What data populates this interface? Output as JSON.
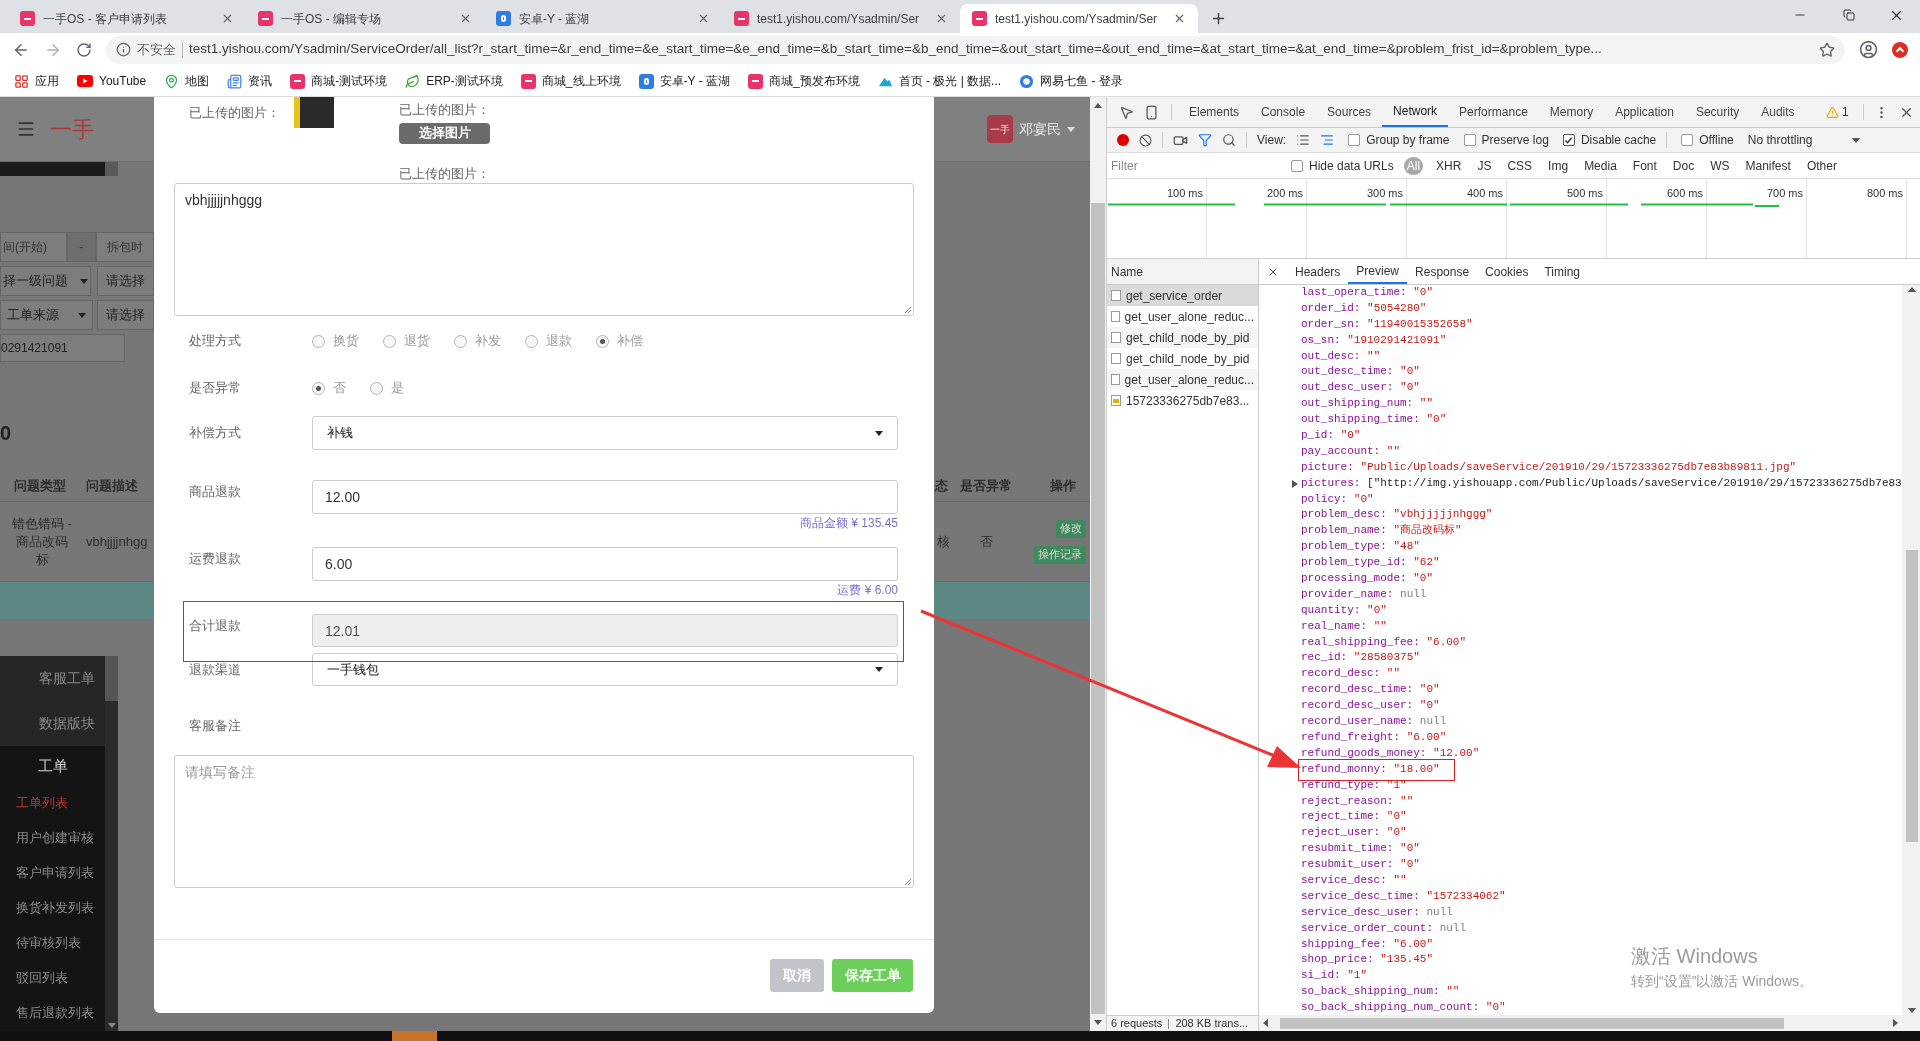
{
  "browser": {
    "tabs": [
      {
        "title": "一手OS - 客户申请列表",
        "kind": "yishou",
        "selected": false
      },
      {
        "title": "一手OS - 编辑专场",
        "kind": "yishou",
        "selected": false
      },
      {
        "title": "安卓-Y - 蓝湖",
        "kind": "lanhu",
        "selected": false
      },
      {
        "title": "test1.yishou.com/Ysadmin/Ser",
        "kind": "yishou",
        "selected": false
      },
      {
        "title": "test1.yishou.com/Ysadmin/Ser",
        "kind": "yishou",
        "selected": true
      }
    ],
    "address_bar": {
      "security": "不安全",
      "url": "test1.yishou.com/Ysadmin/ServiceOrder/all_list?r_start_time=&r_end_time=&e_start_time=&e_end_time=&b_start_time=&b_end_time=&out_start_time=&out_end_time=&at_start_time=&at_end_time=&problem_frist_id=&problem_type..."
    },
    "bookmarks": [
      {
        "label": "应用",
        "kind": "apps"
      },
      {
        "label": "YouTube",
        "kind": "youtube"
      },
      {
        "label": "地图",
        "kind": "maps"
      },
      {
        "label": "资讯",
        "kind": "news"
      },
      {
        "label": "商城-测试环境",
        "kind": "yishou"
      },
      {
        "label": "ERP-测试环境",
        "kind": "erp"
      },
      {
        "label": "商城_线上环境",
        "kind": "yishou"
      },
      {
        "label": "安卓-Y - 蓝湖",
        "kind": "lanhu"
      },
      {
        "label": "商城_预发布环境",
        "kind": "yishou"
      },
      {
        "label": "首页 - 极光 | 数据...",
        "kind": "jiguang"
      },
      {
        "label": "网易七鱼 - 登录",
        "kind": "qiyu"
      }
    ]
  },
  "page": {
    "header": {
      "logo": "一手",
      "user_badge": "一手",
      "user_name": "邓宴民"
    },
    "filters": {
      "start_time": "间(开始)",
      "separator": "-",
      "unpack_time": "拆包时",
      "problem_select": "择一级问题",
      "problem_type_select": "请选择",
      "source_select": "工单来源",
      "source_type_select": "请选择",
      "order_search": "0291421091"
    },
    "total": "0",
    "table": {
      "columns_left": [
        "问题类型",
        "问题描述"
      ],
      "columns_right": [
        "态",
        "是否异常",
        "操作"
      ],
      "row": {
        "problem_type": "错色错码 - 商品改码标",
        "problem_desc": "vbhjjjjnhgg",
        "status": "核",
        "abnormal": "否",
        "actions": [
          "修改",
          "操作记录"
        ]
      }
    },
    "sidebar": {
      "items": [
        {
          "label": "客服工单",
          "selected": false
        },
        {
          "label": "数据版块",
          "selected": false
        }
      ],
      "section": {
        "title": "工单",
        "items": [
          {
            "label": "工单列表",
            "selected": true
          },
          {
            "label": "用户创建审核",
            "selected": false
          },
          {
            "label": "客户申请列表",
            "selected": false
          },
          {
            "label": "换货补发列表",
            "selected": false
          },
          {
            "label": "待审核列表",
            "selected": false
          },
          {
            "label": "驳回列表",
            "selected": false
          },
          {
            "label": "售后退款列表",
            "selected": false
          }
        ]
      }
    }
  },
  "modal": {
    "images_label": "已上传的图片：",
    "upload_label": "已上传的图片：",
    "upload_button": "选择图片",
    "uploaded_label": "已上传的图片：",
    "description": "vbhjjjjjnhggg",
    "processing": {
      "label": "处理方式",
      "options": [
        {
          "label": "换货",
          "selected": false
        },
        {
          "label": "退货",
          "selected": false
        },
        {
          "label": "补发",
          "selected": false
        },
        {
          "label": "退款",
          "selected": false
        },
        {
          "label": "补偿",
          "selected": true
        }
      ]
    },
    "abnormal": {
      "label": "是否异常",
      "options": [
        {
          "label": "否",
          "selected": true
        },
        {
          "label": "是",
          "selected": false
        }
      ]
    },
    "compensation": {
      "label": "补偿方式",
      "value": "补钱"
    },
    "goods_refund": {
      "label": "商品退款",
      "value": "12.00",
      "hint": "商品金额 ¥ 135.45"
    },
    "shipping_refund": {
      "label": "运费退款",
      "value": "6.00",
      "hint": "运费 ¥ 6.00"
    },
    "total_refund": {
      "label": "合计退款",
      "value": "12.01",
      "disabled": true
    },
    "refund_channel": {
      "label": "退款渠道",
      "value": "一手钱包"
    },
    "remark": {
      "label": "客服备注",
      "placeholder": "请填写备注"
    },
    "buttons": [
      {
        "label": "取消",
        "kind": "cancel"
      },
      {
        "label": "保存工单",
        "kind": "primary"
      }
    ]
  },
  "devtools": {
    "tabs": [
      {
        "label": "Elements",
        "selected": false
      },
      {
        "label": "Console",
        "selected": false
      },
      {
        "label": "Sources",
        "selected": false
      },
      {
        "label": "Network",
        "selected": true
      },
      {
        "label": "Performance",
        "selected": false
      },
      {
        "label": "Memory",
        "selected": false
      },
      {
        "label": "Application",
        "selected": false
      },
      {
        "label": "Security",
        "selected": false
      },
      {
        "label": "Audits",
        "selected": false
      }
    ],
    "warnings": "1",
    "toolbar": {
      "recording": true,
      "view_label": "View:",
      "options": [
        {
          "label": "Group by frame",
          "checked": false
        },
        {
          "label": "Preserve log",
          "checked": false
        },
        {
          "label": "Disable cache",
          "checked": true
        },
        {
          "label": "Offline",
          "checked": false
        }
      ],
      "throttling": "No throttling"
    },
    "filter": {
      "placeholder": "Filter",
      "hide_data_urls": {
        "label": "Hide data URLs",
        "checked": false
      },
      "types": [
        {
          "label": "All",
          "selected": true
        },
        {
          "label": "XHR",
          "selected": false
        },
        {
          "label": "JS",
          "selected": false
        },
        {
          "label": "CSS",
          "selected": false
        },
        {
          "label": "Img",
          "selected": false
        },
        {
          "label": "Media",
          "selected": false
        },
        {
          "label": "Font",
          "selected": false
        },
        {
          "label": "Doc",
          "selected": false
        },
        {
          "label": "WS",
          "selected": false
        },
        {
          "label": "Manifest",
          "selected": false
        },
        {
          "label": "Other",
          "selected": false
        }
      ]
    },
    "timeline": {
      "ticks": [
        "100 ms",
        "200 ms",
        "300 ms",
        "400 ms",
        "500 ms",
        "600 ms",
        "700 ms",
        "800 ms"
      ]
    },
    "requests": {
      "header": "Name",
      "items": [
        {
          "name": "get_service_order",
          "kind": "xhr",
          "selected": true
        },
        {
          "name": "get_user_alone_reduc...",
          "kind": "xhr",
          "selected": false
        },
        {
          "name": "get_child_node_by_pid",
          "kind": "xhr",
          "selected": false
        },
        {
          "name": "get_child_node_by_pid",
          "kind": "xhr",
          "selected": false
        },
        {
          "name": "get_user_alone_reduc...",
          "kind": "xhr",
          "selected": false
        },
        {
          "name": "15723336275db7e83...",
          "kind": "image",
          "selected": false
        }
      ]
    },
    "detail_tabs": [
      {
        "label": "Headers",
        "selected": false
      },
      {
        "label": "Preview",
        "selected": true
      },
      {
        "label": "Response",
        "selected": false
      },
      {
        "label": "Cookies",
        "selected": false
      },
      {
        "label": "Timing",
        "selected": false
      }
    ],
    "preview": [
      {
        "key": "last_opera_time:",
        "value": "\"0\"",
        "kind": "string"
      },
      {
        "key": "order_id:",
        "value": "\"5054280\"",
        "kind": "string"
      },
      {
        "key": "order_sn:",
        "value": "\"11940015352658\"",
        "kind": "string"
      },
      {
        "key": "os_sn:",
        "value": "\"1910291421091\"",
        "kind": "string"
      },
      {
        "key": "out_desc:",
        "value": "\"\"",
        "kind": "string"
      },
      {
        "key": "out_desc_time:",
        "value": "\"0\"",
        "kind": "string"
      },
      {
        "key": "out_desc_user:",
        "value": "\"0\"",
        "kind": "string"
      },
      {
        "key": "out_shipping_num:",
        "value": "\"\"",
        "kind": "string"
      },
      {
        "key": "out_shipping_time:",
        "value": "\"0\"",
        "kind": "string"
      },
      {
        "key": "p_id:",
        "value": "\"0\"",
        "kind": "string"
      },
      {
        "key": "pay_account:",
        "value": "\"\"",
        "kind": "string"
      },
      {
        "key": "picture:",
        "value": "\"Public/Uploads/saveService/201910/29/15723336275db7e83b89811.jpg\"",
        "kind": "string"
      },
      {
        "key": "pictures:",
        "value": "[\"http://img.yishouapp.com/Public/Uploads/saveService/201910/29/15723336275db7e83",
        "kind": "array"
      },
      {
        "key": "policy:",
        "value": "\"0\"",
        "kind": "string"
      },
      {
        "key": "problem_desc:",
        "value": "\"vbhjjjjjnhggg\"",
        "kind": "string"
      },
      {
        "key": "problem_name:",
        "value": "\"商品改码标\"",
        "kind": "string"
      },
      {
        "key": "problem_type:",
        "value": "\"48\"",
        "kind": "string"
      },
      {
        "key": "problem_type_id:",
        "value": "\"62\"",
        "kind": "string"
      },
      {
        "key": "processing_mode:",
        "value": "\"0\"",
        "kind": "string"
      },
      {
        "key": "provider_name:",
        "value": "null",
        "kind": "null"
      },
      {
        "key": "quantity:",
        "value": "\"0\"",
        "kind": "string"
      },
      {
        "key": "real_name:",
        "value": "\"\"",
        "kind": "string"
      },
      {
        "key": "real_shipping_fee:",
        "value": "\"6.00\"",
        "kind": "string"
      },
      {
        "key": "rec_id:",
        "value": "\"28580375\"",
        "kind": "string"
      },
      {
        "key": "record_desc:",
        "value": "\"\"",
        "kind": "string"
      },
      {
        "key": "record_desc_time:",
        "value": "\"0\"",
        "kind": "string"
      },
      {
        "key": "record_desc_user:",
        "value": "\"0\"",
        "kind": "string"
      },
      {
        "key": "record_user_name:",
        "value": "null",
        "kind": "null"
      },
      {
        "key": "refund_freight:",
        "value": "\"6.00\"",
        "kind": "string"
      },
      {
        "key": "refund_goods_money:",
        "value": "\"12.00\"",
        "kind": "string"
      },
      {
        "key": "refund_monny:",
        "value": "\"18.00\"",
        "kind": "string",
        "highlighted": true
      },
      {
        "key": "refund_type:",
        "value": "\"1\"",
        "kind": "string"
      },
      {
        "key": "reject_reason:",
        "value": "\"\"",
        "kind": "string"
      },
      {
        "key": "reject_time:",
        "value": "\"0\"",
        "kind": "string"
      },
      {
        "key": "reject_user:",
        "value": "\"0\"",
        "kind": "string"
      },
      {
        "key": "resubmit_time:",
        "value": "\"0\"",
        "kind": "string"
      },
      {
        "key": "resubmit_user:",
        "value": "\"0\"",
        "kind": "string"
      },
      {
        "key": "service_desc:",
        "value": "\"\"",
        "kind": "string"
      },
      {
        "key": "service_desc_time:",
        "value": "\"1572334062\"",
        "kind": "string"
      },
      {
        "key": "service_desc_user:",
        "value": "null",
        "kind": "null"
      },
      {
        "key": "service_order_count:",
        "value": "null",
        "kind": "null"
      },
      {
        "key": "shipping_fee:",
        "value": "\"6.00\"",
        "kind": "string"
      },
      {
        "key": "shop_price:",
        "value": "\"135.45\"",
        "kind": "string"
      },
      {
        "key": "si_id:",
        "value": "\"1\"",
        "kind": "string"
      },
      {
        "key": "so_back_shipping_num:",
        "value": "\"\"",
        "kind": "string"
      },
      {
        "key": "so_back_shipping_num_count:",
        "value": "\"0\"",
        "kind": "string"
      }
    ],
    "status": {
      "requests": "6 requests",
      "transferred": "208 KB trans..."
    }
  },
  "activation_notice": {
    "title": "激活 Windows",
    "subtitle": "转到“设置”以激活 Windows。"
  }
}
